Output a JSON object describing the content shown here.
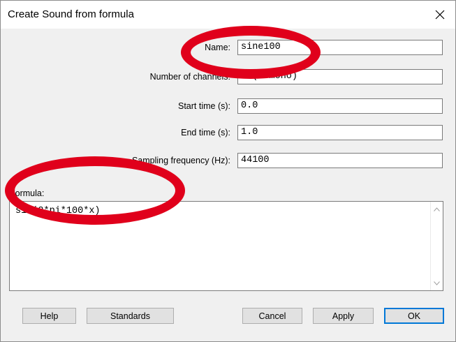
{
  "dialog": {
    "title": "Create Sound from formula",
    "close_symbol": "✕"
  },
  "fields": {
    "name": {
      "label": "Name:",
      "value": "sine100"
    },
    "channels": {
      "label": "Number of channels:",
      "value": "1 (= mono)"
    },
    "start_time": {
      "label": "Start time (s):",
      "value": "0.0"
    },
    "end_time": {
      "label": "End time (s):",
      "value": "1.0"
    },
    "sampling": {
      "label": "Sampling frequency (Hz):",
      "value": "44100"
    }
  },
  "formula": {
    "label": "Formula:",
    "value": "sin(2*pi*100*x)"
  },
  "buttons": {
    "help": "Help",
    "standards": "Standards",
    "cancel": "Cancel",
    "apply": "Apply",
    "ok": "OK"
  },
  "icons": {
    "close": "close-icon",
    "scroll_up": "chevron-up-icon",
    "scroll_down": "chevron-down-icon"
  },
  "colors": {
    "annotation_ring": "#e0001b",
    "default_button_border": "#0078d7"
  }
}
